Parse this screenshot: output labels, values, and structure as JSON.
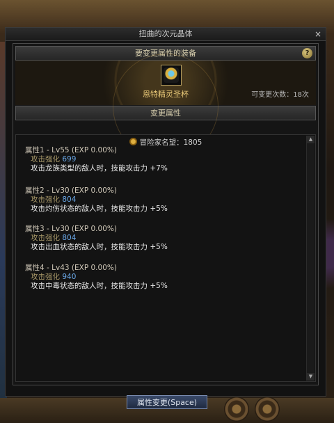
{
  "window": {
    "title": "扭曲的次元晶体",
    "close_glyph": "×"
  },
  "equip_section": {
    "header": "要变更属性的装备",
    "help_glyph": "?"
  },
  "item": {
    "name": "恩特精灵圣杯",
    "change_count": "可变更次数：18次"
  },
  "change_section": {
    "header": "变更属性"
  },
  "fame": {
    "label": "冒险家名望：1805"
  },
  "attributes": [
    {
      "title": "属性1 - Lv55 (EXP 0.00%)",
      "stat_label": "攻击强化",
      "stat_value": "699",
      "effect": "攻击龙族类型的敌人时，技能攻击力 +7%"
    },
    {
      "title": "属性2 - Lv30 (EXP 0.00%)",
      "stat_label": "攻击强化",
      "stat_value": "804",
      "effect": "攻击灼伤状态的敌人时，技能攻击力 +5%"
    },
    {
      "title": "属性3 - Lv30 (EXP 0.00%)",
      "stat_label": "攻击强化",
      "stat_value": "804",
      "effect": "攻击出血状态的敌人时，技能攻击力 +5%"
    },
    {
      "title": "属性4 - Lv43 (EXP 0.00%)",
      "stat_label": "攻击强化",
      "stat_value": "940",
      "effect": "攻击中毒状态的敌人时，技能攻击力 +5%"
    }
  ],
  "scroll": {
    "up": "▲",
    "down": "▼"
  },
  "action_button": {
    "label": "属性变更(Space)"
  },
  "colors": {
    "item_name": "#e8c878",
    "stat_value": "#6aa8e8",
    "button": "#2a3a58"
  }
}
